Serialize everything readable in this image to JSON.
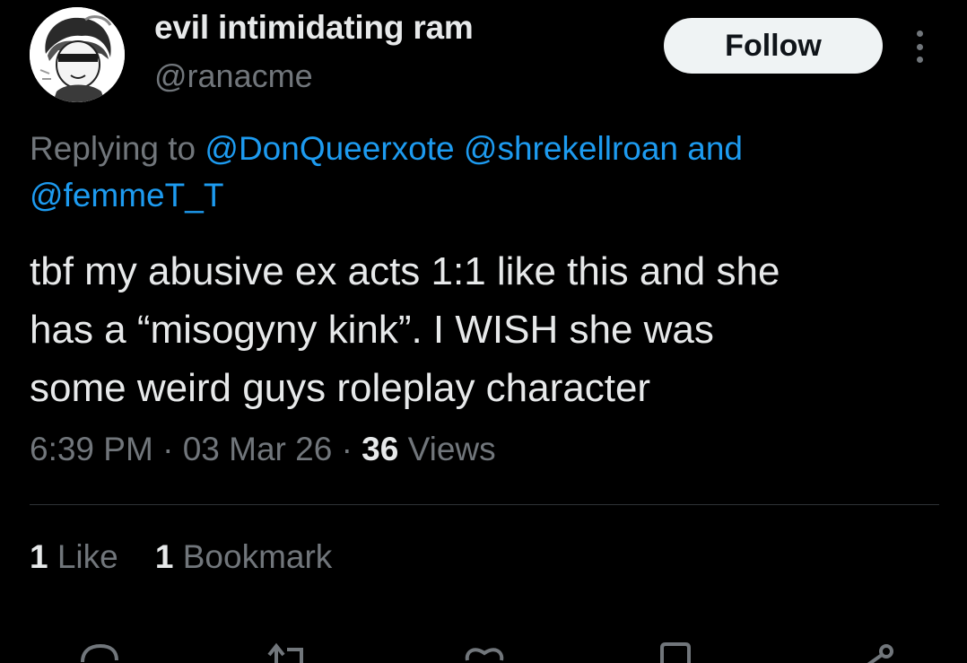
{
  "author": {
    "display_name": "evil intimidating ram",
    "handle": "@ranacme",
    "avatar_icon": "avatar-image"
  },
  "follow_label": "Follow",
  "more_icon": "more-vertical-icon",
  "reply": {
    "prefix": "Replying to",
    "mention_1": "@DonQueerxote",
    "mention_2": "@shrekellroan",
    "conjunction": "and",
    "mention_3": "@femmeT_T"
  },
  "tweet": {
    "lines": [
      "tbf my abusive ex acts 1:1 like this and she",
      "has a “misogyny kink”. I WISH she was",
      "some weird guys roleplay character"
    ]
  },
  "meta": {
    "time": "6:39 PM",
    "separator": "·",
    "date": "03 Mar 26",
    "views_count": "36",
    "views_label": "Views"
  },
  "stats": {
    "likes_count": "1",
    "likes_label": "Like",
    "bookmarks_count": "1",
    "bookmarks_label": "Bookmark"
  },
  "actions": [
    "reply-icon",
    "retweet-icon",
    "like-icon",
    "bookmark-icon",
    "share-icon"
  ],
  "colors": {
    "background": "#000000",
    "text": "#e7e9ea",
    "secondary": "#71767b",
    "accent": "#1d9bf0",
    "divider": "#2f3336"
  }
}
